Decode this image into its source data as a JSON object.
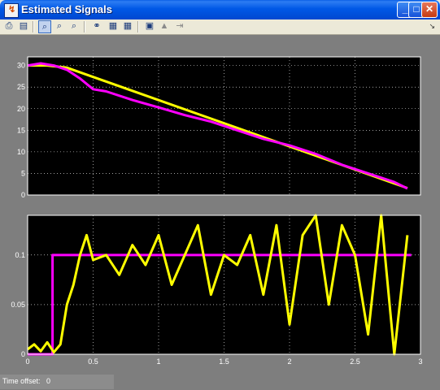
{
  "window": {
    "title": "Estimated Signals"
  },
  "toolbar": {
    "buttons": [
      {
        "icon": "print-icon",
        "glyph": "⎙"
      },
      {
        "icon": "parameters-icon",
        "glyph": "▤"
      },
      {
        "icon": "zoom-icon",
        "glyph": "⌕"
      },
      {
        "icon": "zoom-x-icon",
        "glyph": "⌕"
      },
      {
        "icon": "zoom-y-icon",
        "glyph": "⌕"
      },
      {
        "icon": "autoscale-icon",
        "glyph": "⚭"
      },
      {
        "icon": "save-axes-icon",
        "glyph": "▦"
      },
      {
        "icon": "restore-axes-icon",
        "glyph": "▦"
      },
      {
        "icon": "float-scope-icon",
        "glyph": "▣"
      },
      {
        "icon": "lock-axes-icon",
        "glyph": "▲"
      },
      {
        "icon": "signal-selection-icon",
        "glyph": "⇥"
      }
    ]
  },
  "status": {
    "label": "Time offset:",
    "value": "0"
  },
  "colors": {
    "yellow": "#ffff00",
    "magenta": "#ff00ff",
    "axes_bg": "#000000",
    "figure_bg": "#7e7e7e"
  },
  "chart_data": [
    {
      "type": "line",
      "xlim": [
        0,
        3
      ],
      "ylim": [
        0,
        32
      ],
      "x_ticks": [],
      "y_ticks": [
        0,
        5,
        10,
        15,
        20,
        25,
        30
      ],
      "grid": true,
      "series": [
        {
          "color": "#ffff00",
          "x": [
            0,
            0.15,
            0.3,
            2.9
          ],
          "y": [
            30,
            30,
            29.5,
            1.6
          ]
        },
        {
          "color": "#ff00ff",
          "x": [
            0,
            0.1,
            0.2,
            0.3,
            0.4,
            0.5,
            0.6,
            0.8,
            1.0,
            1.2,
            1.4,
            1.6,
            1.8,
            2.0,
            2.2,
            2.4,
            2.6,
            2.8,
            2.9
          ],
          "y": [
            30,
            30.5,
            30,
            29,
            27,
            24.5,
            24,
            22,
            20.3,
            18.5,
            17,
            15,
            13,
            11.5,
            9.5,
            7,
            5,
            3,
            1.5
          ]
        }
      ]
    },
    {
      "type": "line",
      "xlim": [
        0,
        3
      ],
      "ylim": [
        0,
        0.14
      ],
      "x_ticks": [
        0,
        0.5,
        1,
        1.5,
        2,
        2.5,
        3
      ],
      "y_ticks": [
        0,
        0.05,
        0.1
      ],
      "grid": true,
      "series": [
        {
          "color": "#ff00ff",
          "x": [
            0,
            0.19,
            0.19,
            2.93
          ],
          "y": [
            0,
            0,
            0.1,
            0.1
          ]
        },
        {
          "color": "#ffff00",
          "x": [
            0,
            0.05,
            0.1,
            0.15,
            0.2,
            0.25,
            0.3,
            0.35,
            0.4,
            0.45,
            0.5,
            0.6,
            0.7,
            0.8,
            0.9,
            1.0,
            1.1,
            1.2,
            1.3,
            1.4,
            1.5,
            1.6,
            1.7,
            1.8,
            1.9,
            2.0,
            2.1,
            2.2,
            2.3,
            2.4,
            2.5,
            2.6,
            2.7,
            2.8,
            2.9
          ],
          "y": [
            0.005,
            0.01,
            0.003,
            0.012,
            0.002,
            0.01,
            0.05,
            0.07,
            0.1,
            0.12,
            0.095,
            0.1,
            0.08,
            0.11,
            0.09,
            0.12,
            0.07,
            0.1,
            0.13,
            0.06,
            0.1,
            0.09,
            0.12,
            0.06,
            0.13,
            0.03,
            0.12,
            0.14,
            0.05,
            0.13,
            0.1,
            0.02,
            0.14,
            0.0,
            0.12
          ]
        }
      ]
    }
  ]
}
